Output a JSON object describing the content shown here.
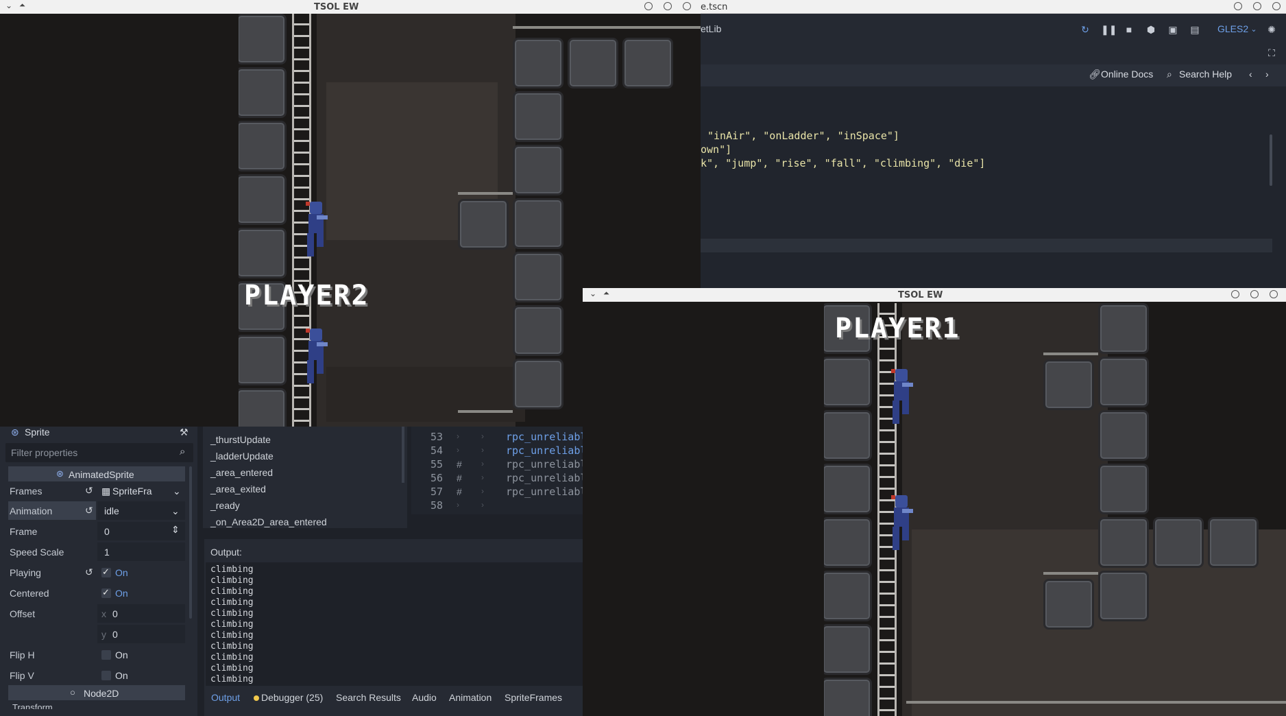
{
  "editor": {
    "title": "e.tscn",
    "tab_text": "etLib",
    "gles": "GLES2",
    "help": {
      "online_docs": "Online Docs",
      "search_help": "Search Help"
    },
    "code_lines": [
      "\"inAir\", \"onLadder\", \"inSpace\"]",
      "own\"]",
      "k\", \"jump\", \"rise\", \"fall\", \"climbing\", \"die\"]"
    ]
  },
  "inspector": {
    "node_name": "Sprite",
    "filter_placeholder": "Filter properties",
    "section_animated": "AnimatedSprite",
    "section_node2d": "Node2D",
    "section_transform": "Transform",
    "props": {
      "frames_label": "Frames",
      "frames_value": "SpriteFra",
      "animation_label": "Animation",
      "animation_value": "idle",
      "frame_label": "Frame",
      "frame_value": "0",
      "speed_label": "Speed Scale",
      "speed_value": "1",
      "playing_label": "Playing",
      "playing_value": "On",
      "centered_label": "Centered",
      "centered_value": "On",
      "offset_label": "Offset",
      "offset_x": "0",
      "offset_y": "0",
      "fliph_label": "Flip H",
      "fliph_value": "On",
      "flipv_label": "Flip V",
      "flipv_value": "On"
    }
  },
  "methods": [
    "_thurstUpdate",
    "_ladderUpdate",
    "_area_entered",
    "_area_exited",
    "_ready",
    "_on_Area2D_area_entered"
  ],
  "script_lines": [
    {
      "num": "53",
      "code": "rpc_unreliabl",
      "comment": false
    },
    {
      "num": "54",
      "code": "rpc_unreliabl",
      "comment": false
    },
    {
      "num": "55",
      "code": "rpc_unreliabl",
      "comment": true
    },
    {
      "num": "56",
      "code": "rpc_unreliabl",
      "comment": true
    },
    {
      "num": "57",
      "code": "rpc_unreliabl",
      "comment": true
    },
    {
      "num": "58",
      "code": "",
      "comment": false
    }
  ],
  "output": {
    "label": "Output:",
    "lines": [
      "climbing",
      "climbing",
      "climbing",
      "climbing",
      "climbing",
      "climbing",
      "climbing",
      "climbing",
      "climbing",
      "climbing",
      "climbing"
    ]
  },
  "bottom_tabs": {
    "output": "Output",
    "debugger": "Debugger (25)",
    "search": "Search Results",
    "audio": "Audio",
    "animation": "Animation",
    "spriteframes": "SpriteFrames"
  },
  "game_windows": {
    "left": {
      "title": "TSOL EW",
      "player_label": "PLAYER2"
    },
    "right": {
      "title": "TSOL EW",
      "player_label": "PLAYER1"
    }
  },
  "colors": {
    "accent": "#6ea0e8",
    "panel": "#262a33",
    "titlebar": "#f1f1f1"
  }
}
